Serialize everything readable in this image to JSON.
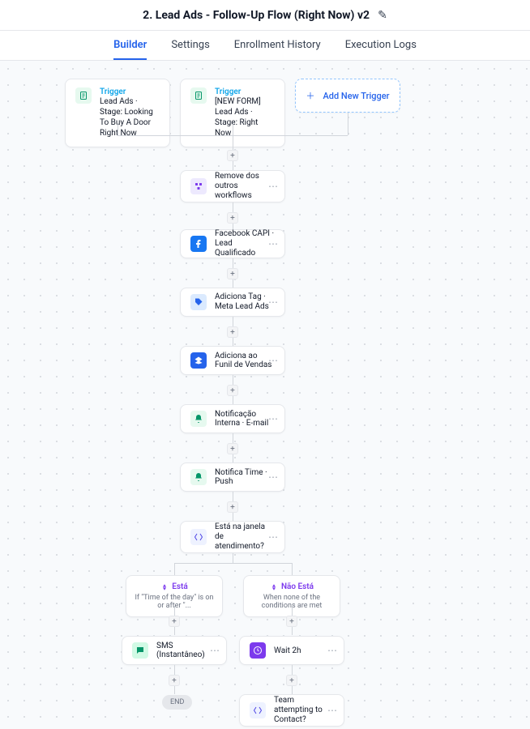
{
  "header": {
    "title": "2. Lead Ads - Follow-Up Flow (Right Now) v2"
  },
  "tabs": {
    "builder": "Builder",
    "settings": "Settings",
    "enrollment": "Enrollment History",
    "logs": "Execution Logs"
  },
  "triggers": [
    {
      "label": "Trigger",
      "text": "Lead Ads · Stage: Looking To Buy A Door Right Now"
    },
    {
      "label": "Trigger",
      "text": "[NEW FORM] Lead Ads · Stage: Right Now"
    }
  ],
  "addTrigger": "Add New Trigger",
  "actions": {
    "a1": "Remove dos outros workflows",
    "a2": "Facebook CAPI · Lead Qualificado",
    "a3": "Adiciona Tag · Meta Lead Ads",
    "a4": "Adiciona ao Funil de Vendas",
    "a5": "Notificação Interna · E-mail",
    "a6": "Notifica Time · Push",
    "a7": "Está na janela de atendimento?"
  },
  "branches": {
    "yes": {
      "title": "Está",
      "desc": "If \"Time of the day\" is on or after \"..."
    },
    "no": {
      "title": "Não Está",
      "desc": "When none of the conditions are met"
    }
  },
  "leafLeft": "SMS (Instantâneo)",
  "leafRight1": "Wait 2h",
  "leafRight2": "Team attempting to Contact?",
  "end": "END",
  "connector": "+"
}
